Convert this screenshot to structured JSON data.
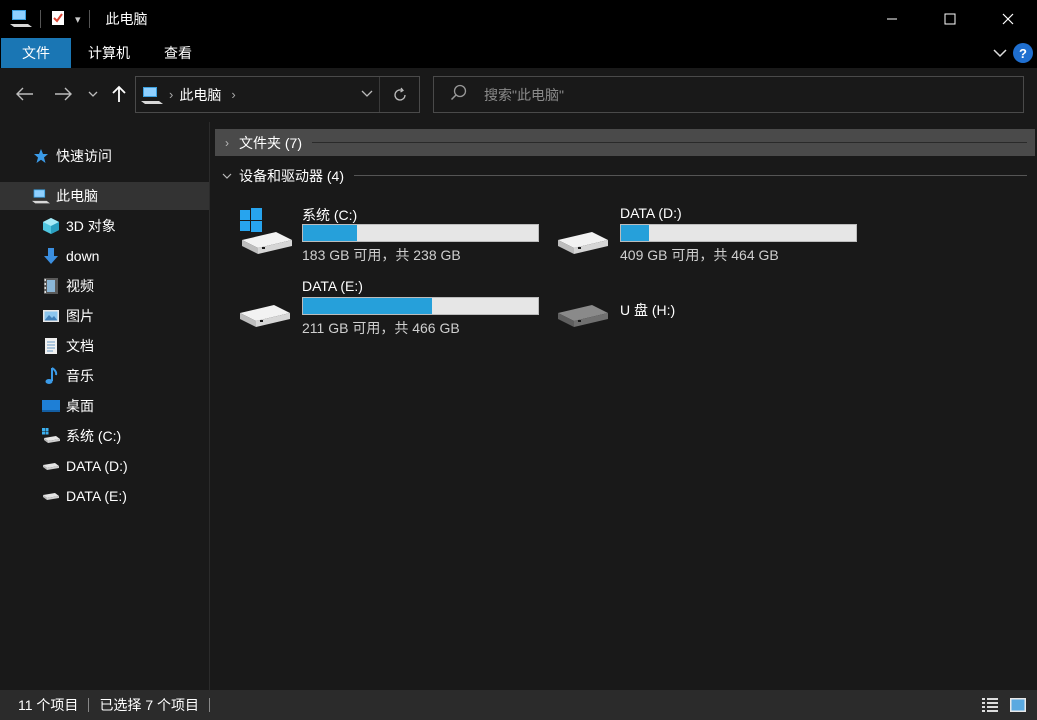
{
  "window": {
    "title": "此电脑",
    "quick_access_customize": "▾"
  },
  "ribbon": {
    "tabs": [
      {
        "label": "文件",
        "active": true
      },
      {
        "label": "计算机",
        "active": false
      },
      {
        "label": "查看",
        "active": false
      }
    ],
    "help": "?"
  },
  "navbar": {
    "breadcrumb": [
      "此电脑"
    ],
    "search_placeholder": "搜索\"此电脑\""
  },
  "sidebar": {
    "items": [
      {
        "label": "快速访问",
        "icon": "star-icon"
      },
      {
        "label": "此电脑",
        "icon": "computer-icon",
        "selected": true
      },
      {
        "label": "3D 对象",
        "icon": "cube-icon"
      },
      {
        "label": "down",
        "icon": "download-arrow-icon"
      },
      {
        "label": "视频",
        "icon": "video-icon"
      },
      {
        "label": "图片",
        "icon": "picture-icon"
      },
      {
        "label": "文档",
        "icon": "document-icon"
      },
      {
        "label": "音乐",
        "icon": "music-note-icon"
      },
      {
        "label": "桌面",
        "icon": "desktop-icon"
      },
      {
        "label": "系统 (C:)",
        "icon": "system-drive-icon"
      },
      {
        "label": "DATA (D:)",
        "icon": "drive-icon"
      },
      {
        "label": "DATA (E:)",
        "icon": "drive-icon"
      }
    ]
  },
  "content": {
    "folders_group": "文件夹 (7)",
    "devices_group": "设备和驱动器 (4)",
    "drives": [
      {
        "name": "系统 (C:)",
        "size_text": "183 GB 可用，共 238 GB",
        "used_fraction": 0.23,
        "type": "system"
      },
      {
        "name": "DATA (D:)",
        "size_text": "409 GB 可用，共 464 GB",
        "used_fraction": 0.12,
        "type": "hdd"
      },
      {
        "name": "DATA (E:)",
        "size_text": "211 GB 可用，共 466 GB",
        "used_fraction": 0.55,
        "type": "hdd"
      },
      {
        "name": "U 盘 (H:)",
        "size_text": "",
        "used_fraction": null,
        "type": "removable"
      }
    ]
  },
  "statusbar": {
    "item_count": "11 个项目",
    "selected_count": "已选择 7 个项目"
  },
  "colors": {
    "accent": "#1a76b4",
    "bar_fill": "#26a0da",
    "background": "#191919"
  }
}
